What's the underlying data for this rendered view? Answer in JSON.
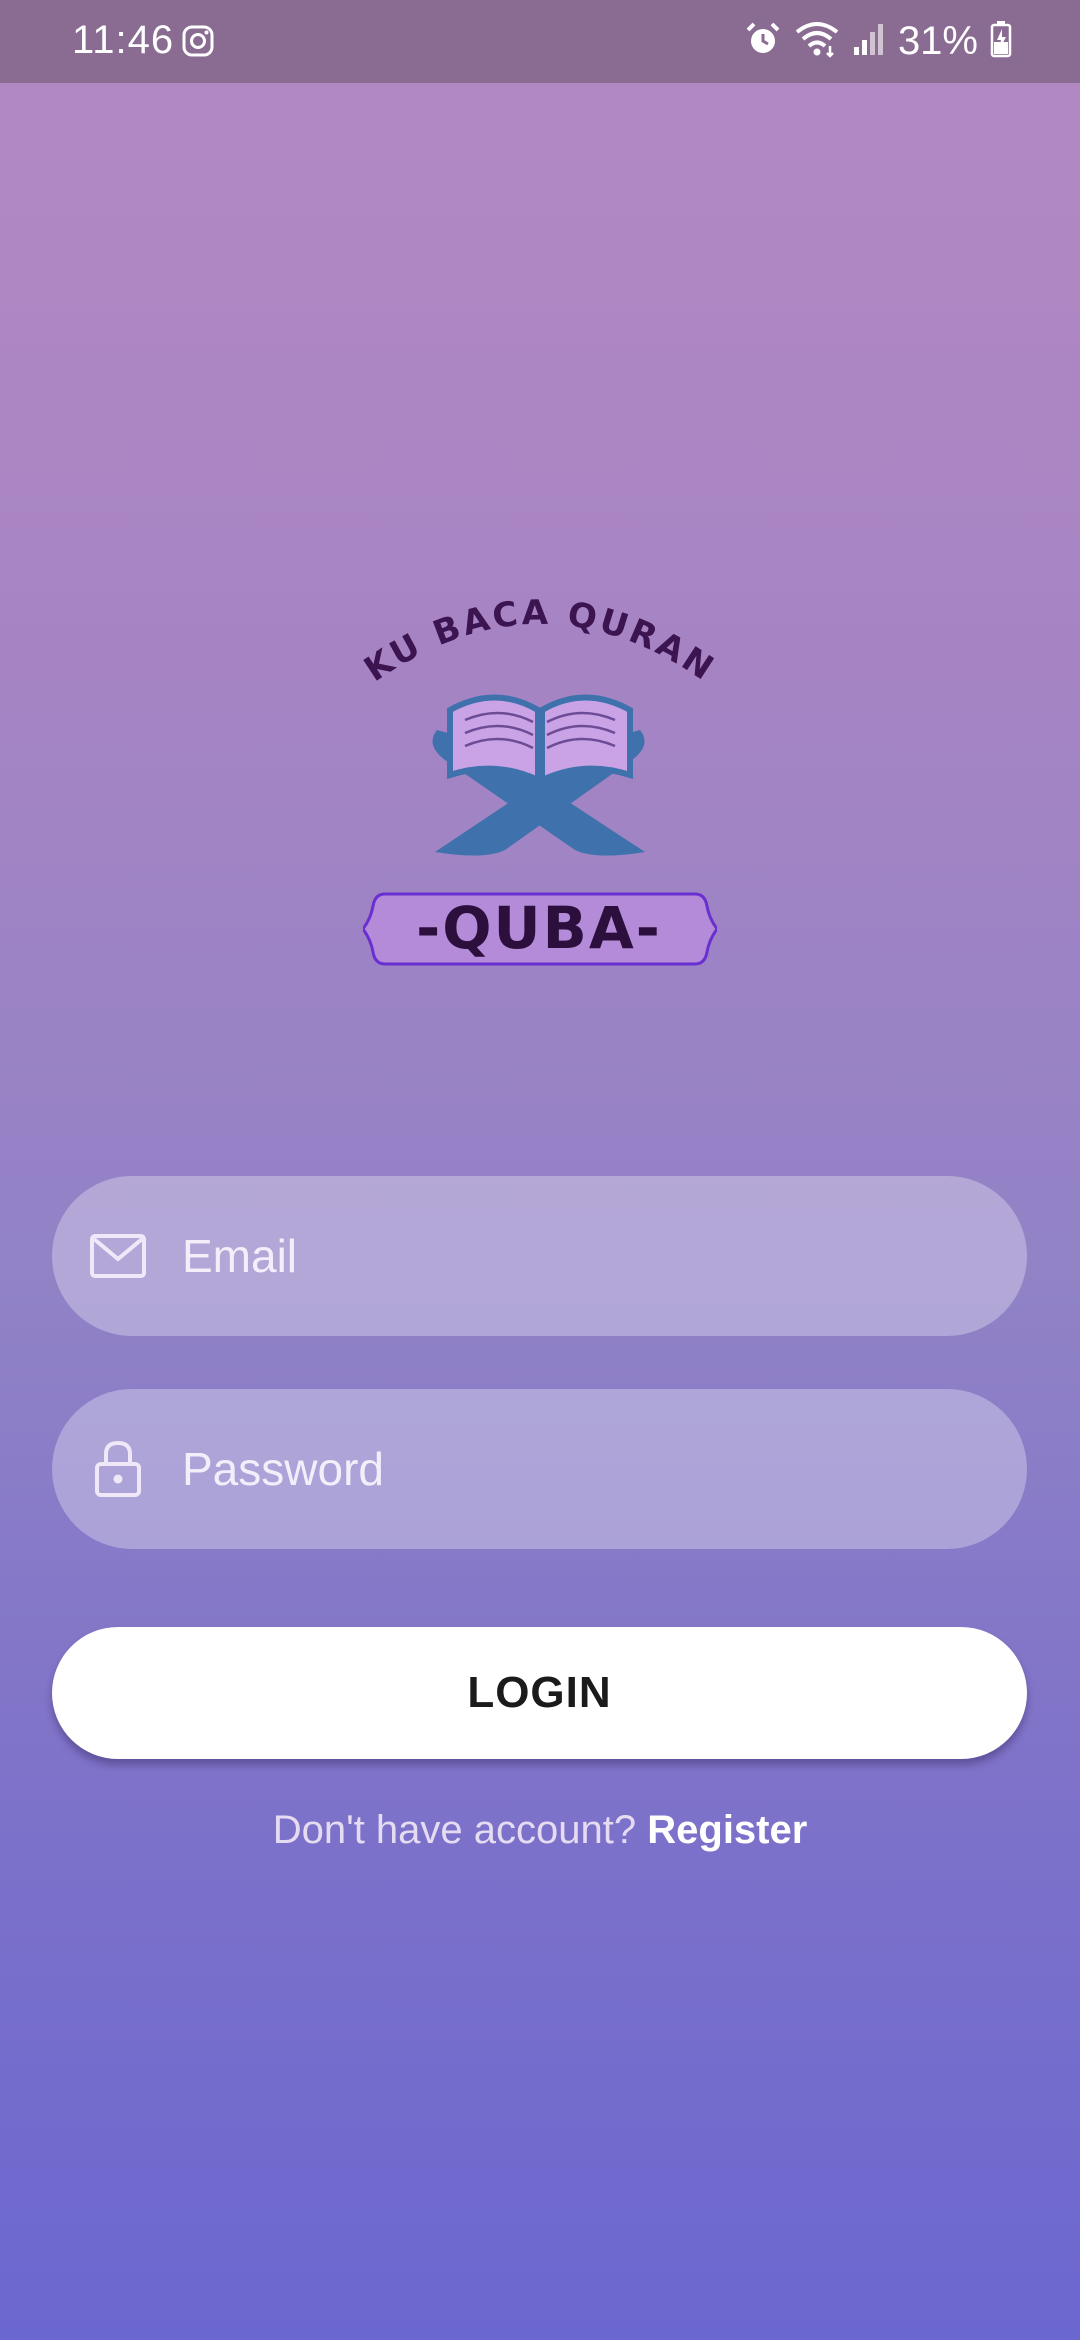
{
  "status_bar": {
    "time": "11:46",
    "battery_percent": "31%",
    "icons": [
      "instagram-icon",
      "alarm-icon",
      "wifi-icon",
      "signal-icon",
      "battery-charging-icon"
    ]
  },
  "logo": {
    "arc_text": "KU BACA QURAN",
    "badge_text": "-QUBA-"
  },
  "form": {
    "email_placeholder": "Email",
    "email_value": "",
    "email_icon": "mail-icon",
    "password_placeholder": "Password",
    "password_value": "",
    "password_icon": "lock-icon",
    "login_label": "LOGIN"
  },
  "register": {
    "prompt": "Don't have account? ",
    "link_label": "Register"
  },
  "colors": {
    "status_bar": "#8a6c92",
    "gradient_top": "#b489c2",
    "gradient_bottom": "#6b67d0",
    "button_bg": "#ffffff",
    "logo_book_blue": "#3f72ad",
    "logo_purple": "#b38bd9"
  }
}
